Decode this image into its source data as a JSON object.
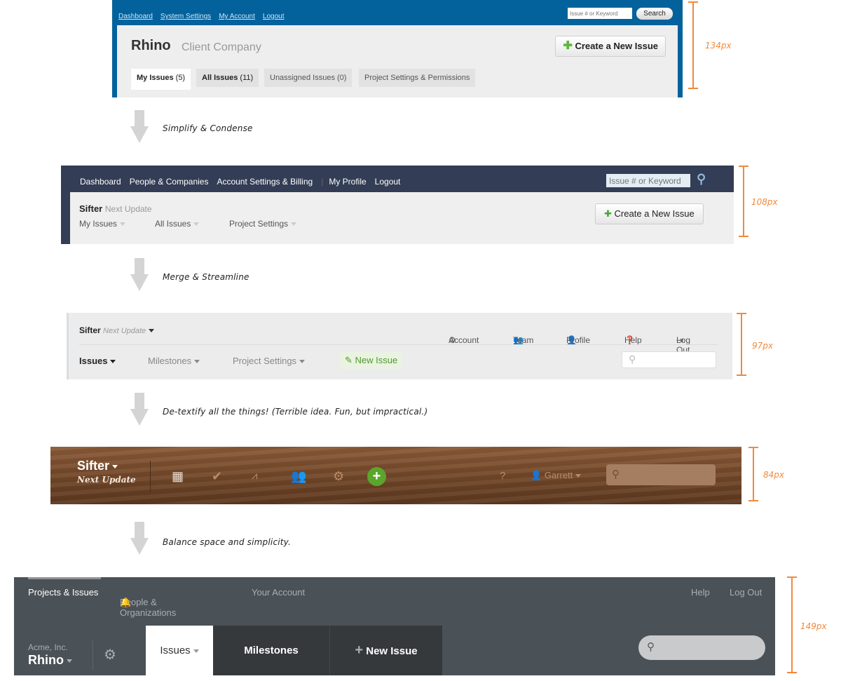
{
  "steps": [
    {
      "caption": "Simplify & Condense"
    },
    {
      "caption": "Merge & Streamline"
    },
    {
      "caption": "De-textify all the things! (Terrible idea. Fun, but impractical.)"
    },
    {
      "caption": "Balance space and simplicity."
    }
  ],
  "measurements": [
    "134px",
    "108px",
    "97px",
    "84px",
    "149px"
  ],
  "v1": {
    "nav": [
      "Dashboard",
      "System Settings",
      "My Account",
      "Logout"
    ],
    "search_placeholder": "Issue # or Keyword",
    "search_button": "Search",
    "project": "Rhino",
    "company": "Client Company",
    "create_button": "Create a New Issue",
    "tabs": [
      {
        "label": "My Issues",
        "count": "(5)"
      },
      {
        "label": "All Issues",
        "count": "(11)"
      },
      {
        "label": "Unassigned Issues (0)"
      },
      {
        "label": "Project Settings & Permissions"
      }
    ],
    "colors": {
      "header": "#03629c"
    }
  },
  "v2": {
    "nav": [
      "Dashboard",
      "People & Companies",
      "Account Settings & Billing",
      "My Profile",
      "Logout"
    ],
    "search_placeholder": "Issue # or Keyword",
    "project": "Sifter",
    "milestone": "Next Update",
    "tabs": [
      "My Issues",
      "All Issues",
      "Project Settings"
    ],
    "create_button": "Create a New Issue",
    "colors": {
      "header": "#333d55"
    }
  },
  "v3": {
    "project": "Sifter",
    "milestone": "Next Update",
    "top_links": [
      "Account",
      "Team",
      "Profile",
      "Help",
      "Log Out"
    ],
    "tabs": [
      "Issues",
      "Milestones",
      "Project Settings"
    ],
    "new_issue": "New Issue",
    "colors": {
      "new_issue": "#5a9e2f"
    }
  },
  "v4": {
    "project": "Sifter",
    "milestone": "Next Update",
    "user": "Garrett",
    "icons": [
      "calendar-icon",
      "checkmark-icon",
      "activity-icon",
      "team-icon",
      "gear-icon",
      "add-icon",
      "help-icon",
      "user-icon",
      "search-icon"
    ]
  },
  "v5": {
    "nav": [
      "Projects & Issues",
      "People & Organizations",
      "Your Account"
    ],
    "right_nav": [
      "Help",
      "Log Out"
    ],
    "organization": "Acme, Inc.",
    "project": "Rhino",
    "tabs": [
      "Issues",
      "Milestones",
      "New Issue"
    ],
    "colors": {
      "header": "#4a5157",
      "tab_dark": "#35393c"
    }
  }
}
